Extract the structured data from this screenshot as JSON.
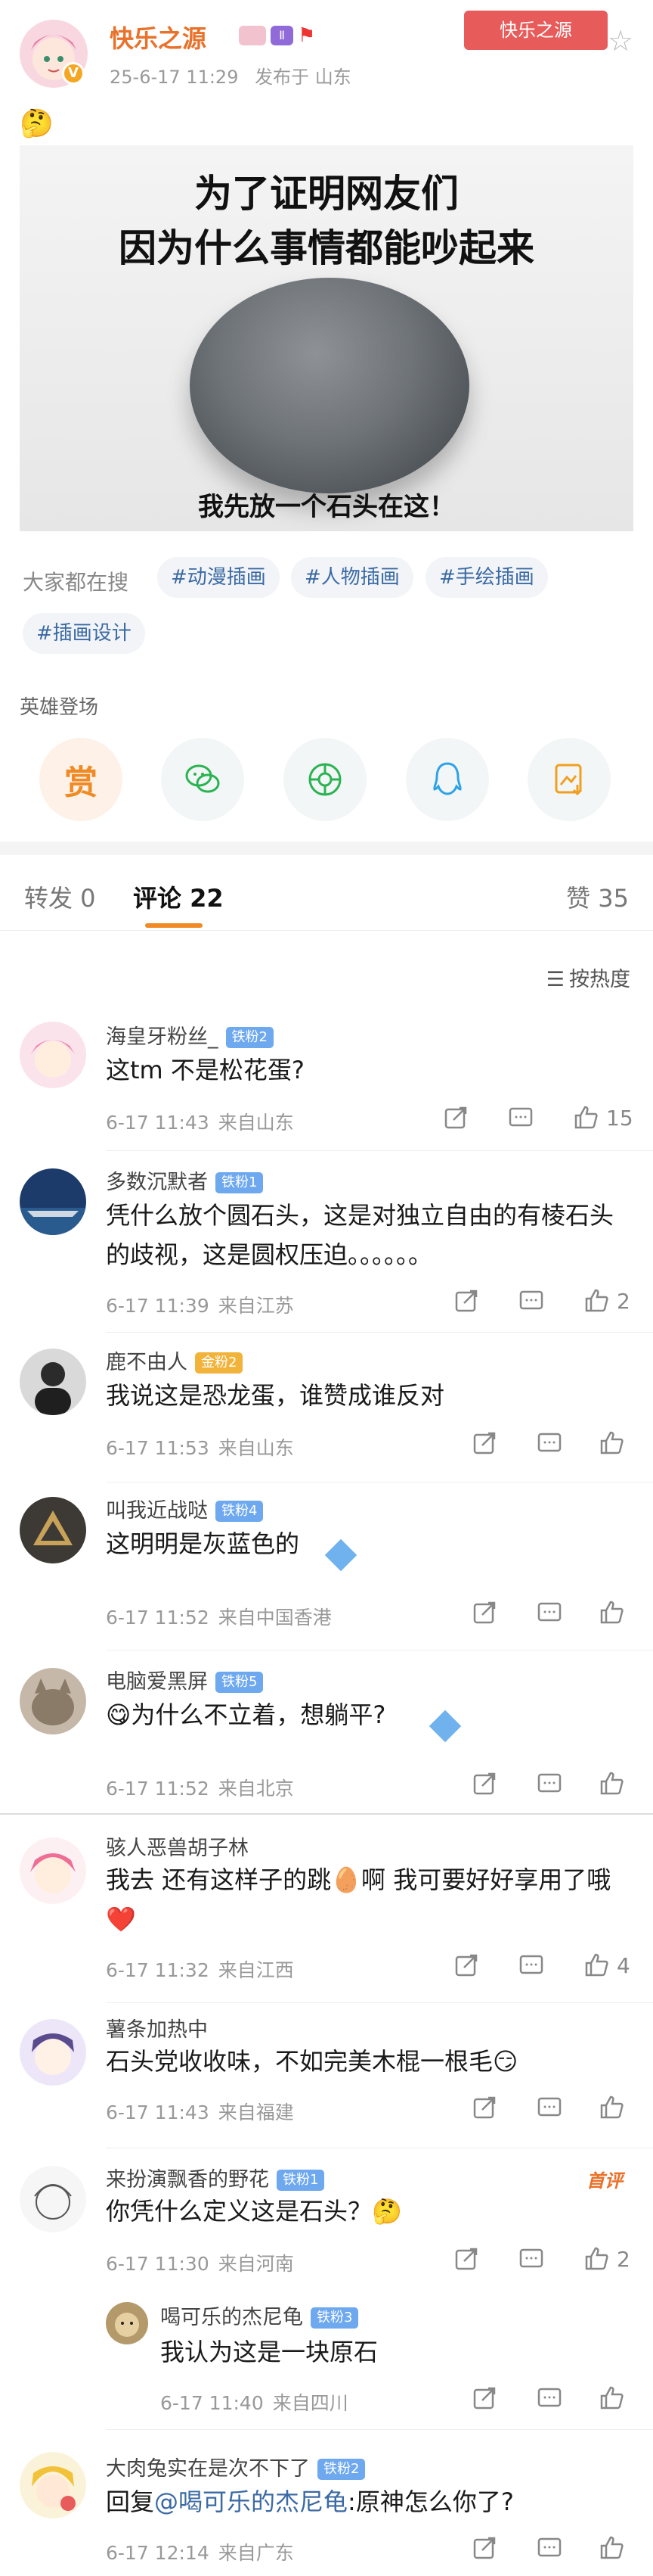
{
  "post": {
    "author": "快乐之源",
    "date": "25-6-17 11:29",
    "publish_label": "发布于 山东",
    "fan_tag": "快乐之源",
    "emoji": "🤔",
    "image_caption_line1": "为了证明网友们",
    "image_caption_line2": "因为什么事情都能吵起来",
    "image_caption_bottom": "我先放一个石头在这！",
    "search_label": "大家都在搜",
    "topics": [
      "#动漫插画",
      "#人物插画",
      "#手绘插画",
      "#插画设计"
    ],
    "heroes_label": "英雄登场",
    "share_icons": [
      "reward-icon",
      "wechat-icon",
      "moments-icon",
      "qq-icon",
      "save-image-icon"
    ],
    "reward_label": "赏"
  },
  "tabs": {
    "repost": "转发 0",
    "comments": "评论 22",
    "likes": "赞 35"
  },
  "sort_label": "按热度",
  "comments": [
    {
      "name": "海皇牙粉丝_",
      "badge": "铁粉2",
      "text": "这tm 不是松花蛋?",
      "time": "6-17 11:43",
      "location": "来自山东",
      "likes": "15"
    },
    {
      "name": "多数沉默者",
      "badge": "铁粉1",
      "text": "凭什么放个圆石头，这是对独立自由的有棱石头的歧视，这是圆权压迫。。。。。。",
      "time": "6-17 11:39",
      "location": "来自江苏",
      "likes": "2"
    },
    {
      "name": "鹿不由人",
      "badge": "金粉2",
      "text": "我说这是恐龙蛋，谁赞成谁反对",
      "time": "6-17 11:53",
      "location": "来自山东",
      "likes": ""
    },
    {
      "name": "叫我近战哒",
      "badge": "铁粉4",
      "text": "这明明是灰蓝色的",
      "time": "6-17 11:52",
      "location": "来自中国香港",
      "likes": ""
    },
    {
      "name": "电脑爱黑屏",
      "badge": "铁粉5",
      "text": "😋为什么不立着，想躺平?",
      "time": "6-17 11:52",
      "location": "来自北京",
      "likes": ""
    },
    {
      "name": "骇人恶兽胡子林",
      "badge": "",
      "text": "我去 还有这样子的跳🥚啊 我可要好好享用了哦❤️",
      "time": "6-17 11:32",
      "location": "来自江西",
      "likes": "4"
    },
    {
      "name": "薯条加热中",
      "badge": "",
      "text": "石头党收收味，不如完美木棍一根毛😏",
      "time": "6-17 11:43",
      "location": "来自福建",
      "likes": ""
    },
    {
      "name": "来扮演飘香的野花",
      "badge": "铁粉1",
      "text": "你凭什么定义这是石头？🤔",
      "time": "6-17 11:30",
      "location": "来自河南",
      "likes": "2",
      "hot": "首评"
    },
    {
      "name": "喝可乐的杰尼龟",
      "badge": "铁粉3",
      "text": "我认为这是一块原石",
      "time": "6-17 11:40",
      "location": "来自四川",
      "likes": ""
    },
    {
      "name": "大肉兔实在是次不下了",
      "badge": "铁粉2",
      "text_prefix": "回复",
      "text_mention": "@喝可乐的杰尼龟",
      "text_rest": ":原神怎么你了?",
      "time": "6-17 12:14",
      "location": "来自广东",
      "likes": ""
    }
  ]
}
